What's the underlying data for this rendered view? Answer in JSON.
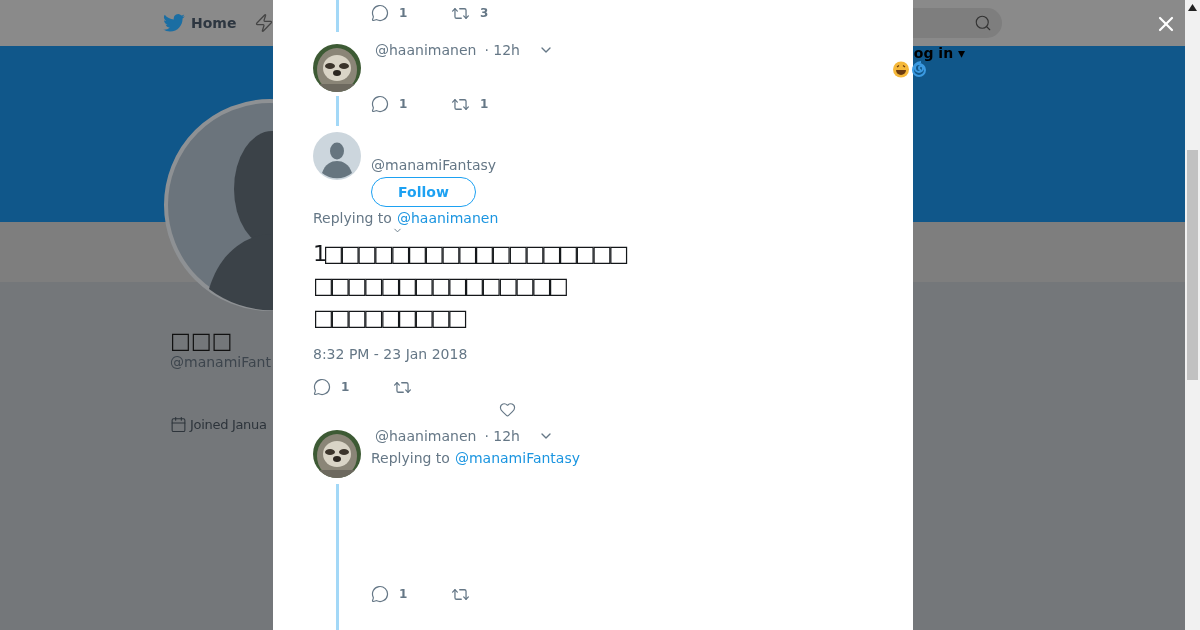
{
  "header": {
    "nav": [
      {
        "label": "Home",
        "selected": true
      }
    ],
    "login": "og in ▾"
  },
  "profile": {
    "name": "□□□",
    "handle": "@manamiFant",
    "joined": "Joined Janua"
  },
  "modal": {
    "tweets": [
      {
        "kind": "partial",
        "replies": "1",
        "retweets": "3"
      },
      {
        "kind": "reply",
        "handle": "@haanimanen",
        "time": "· 12h",
        "replies": "1",
        "retweets": "1",
        "thread_below": true
      },
      {
        "kind": "focus",
        "handle": "@manamiFantasy",
        "follow": "Follow",
        "replying_label": "Replying to",
        "replying_to": "@haanimanen",
        "text": [
          "1□□□□□□□□□□□□□□□□□□",
          "□□□□□□□□□□□□□□□",
          "□□□□□□□□□"
        ],
        "timestamp": "8:32 PM - 23 Jan 2018",
        "replies": "1"
      },
      {
        "kind": "media_reply",
        "handle": "@haanimanen",
        "time": "· 12h",
        "replying_label": "Replying to",
        "replying_to": "@manamiFantasy",
        "replies": "1",
        "thread_below": true
      }
    ]
  }
}
